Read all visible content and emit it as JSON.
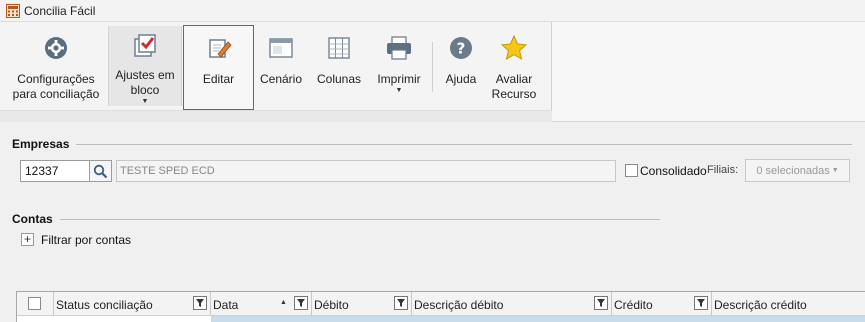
{
  "window": {
    "title": "Concilia Fácil"
  },
  "ribbon": {
    "configuracoes": "Configurações\npara conciliação",
    "ajustes": "Ajustes em\nbloco",
    "editar": "Editar",
    "cenario": "Cenário",
    "colunas": "Colunas",
    "imprimir": "Imprimir",
    "ajuda": "Ajuda",
    "avaliar": "Avaliar\nRecurso"
  },
  "empresas": {
    "title": "Empresas",
    "code": "12337",
    "name": "TESTE SPED ECD",
    "consolidado_label": "Consolidado",
    "consolidado_checked": false,
    "filiais_label": "Filiais:",
    "filiais_value": "0 selecionadas"
  },
  "contas": {
    "title": "Contas",
    "filtrar_label": "Filtrar por contas"
  },
  "grid": {
    "columns": [
      "Status conciliação",
      "Data",
      "Débito",
      "Descrição débito",
      "Crédito",
      "Descrição crédito"
    ]
  },
  "colors": {
    "focus_border": "#d23a3a",
    "row_selected": "#c9dceb"
  }
}
